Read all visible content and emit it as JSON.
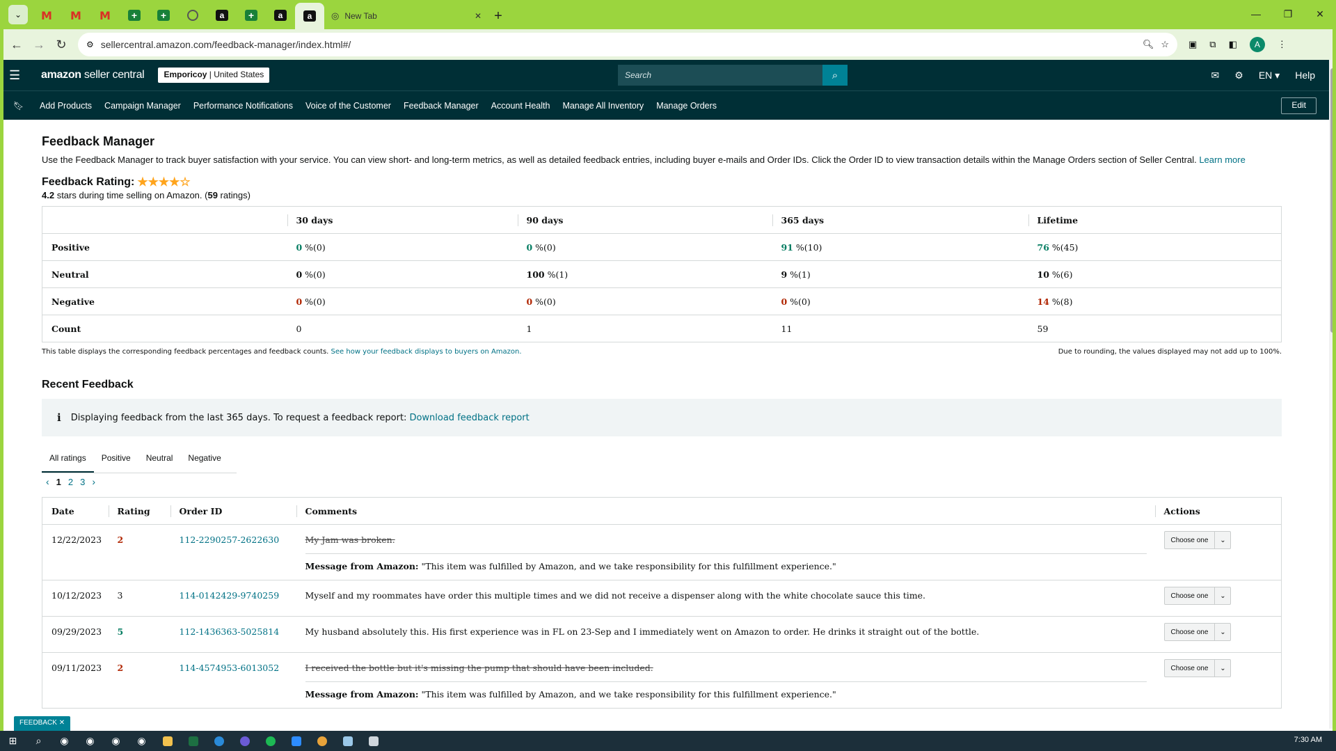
{
  "browser": {
    "tabs": [
      {
        "type": "gmail"
      },
      {
        "type": "gmail"
      },
      {
        "type": "gmail"
      },
      {
        "type": "sheets"
      },
      {
        "type": "sheets"
      },
      {
        "type": "globe"
      },
      {
        "type": "amazon"
      },
      {
        "type": "sheets"
      },
      {
        "type": "amazon"
      }
    ],
    "active_tab_favicon": "a",
    "new_tab_title": "New Tab",
    "url": "sellercentral.amazon.com/feedback-manager/index.html#/"
  },
  "header": {
    "logo_brand": "amazon",
    "logo_rest": " seller central",
    "store_name": "Emporicoy",
    "store_region": " | United States",
    "search_placeholder": "Search",
    "language": "EN",
    "help": "Help"
  },
  "nav": {
    "items": [
      "Add Products",
      "Campaign Manager",
      "Performance Notifications",
      "Voice of the Customer",
      "Feedback Manager",
      "Account Health",
      "Manage All Inventory",
      "Manage Orders"
    ],
    "edit_label": "Edit"
  },
  "page": {
    "title": "Feedback Manager",
    "intro": "Use the Feedback Manager to track buyer satisfaction with your service. You can view short- and long-term metrics, as well as detailed feedback entries, including buyer e-mails and Order IDs. Click the Order ID to view transaction details within the Manage Orders section of Seller Central. ",
    "learn_more": "Learn more",
    "rating_label": "Feedback Rating:",
    "rating_stars": "★★★★☆",
    "rating_value": "4.2",
    "rating_text_mid": " stars during time selling on Amazon. (",
    "rating_count": "59",
    "rating_text_end": " ratings)"
  },
  "metrics": {
    "columns": [
      "30 days",
      "90 days",
      "365 days",
      "Lifetime"
    ],
    "rows": [
      {
        "label": "Positive",
        "cells": [
          {
            "v": "0",
            "rest": " %(0)"
          },
          {
            "v": "0",
            "rest": " %(0)"
          },
          {
            "v": "91",
            "rest": " %(10)"
          },
          {
            "v": "76",
            "rest": " %(45)"
          }
        ]
      },
      {
        "label": "Neutral",
        "cells": [
          {
            "v": "0",
            "rest": " %(0)"
          },
          {
            "v": "100",
            "rest": " %(1)"
          },
          {
            "v": "9",
            "rest": " %(1)"
          },
          {
            "v": "10",
            "rest": " %(6)"
          }
        ]
      },
      {
        "label": "Negative",
        "cells": [
          {
            "v": "0",
            "rest": " %(0)"
          },
          {
            "v": "0",
            "rest": " %(0)"
          },
          {
            "v": "0",
            "rest": " %(0)"
          },
          {
            "v": "14",
            "rest": " %(8)"
          }
        ]
      },
      {
        "label": "Count",
        "cells": [
          {
            "v": "0",
            "rest": ""
          },
          {
            "v": "1",
            "rest": ""
          },
          {
            "v": "11",
            "rest": ""
          },
          {
            "v": "59",
            "rest": ""
          }
        ]
      }
    ],
    "note_left": "This table displays the corresponding feedback percentages and feedback counts. ",
    "note_link": "See how your feedback displays to buyers on Amazon.",
    "note_right": "Due to rounding, the values displayed may not add up to 100%."
  },
  "recent": {
    "title": "Recent Feedback",
    "info_text": "Displaying feedback from the last 365 days. To request a feedback report: ",
    "info_link": "Download feedback report",
    "tabs": [
      "All ratings",
      "Positive",
      "Neutral",
      "Negative"
    ],
    "pages": [
      "1",
      "2",
      "3"
    ],
    "columns": [
      "Date",
      "Rating",
      "Order ID",
      "Comments",
      "Actions"
    ],
    "rows": [
      {
        "date": "12/22/2023",
        "rating": "2",
        "order_id": "112-2290257-2622630",
        "comment": "My Jam was broken.",
        "struck": true,
        "amazon_label": "Message from Amazon:",
        "amazon_msg": " \"This item was fulfilled by Amazon, and we take responsibility for this fulfillment experience.\"",
        "action": "Choose one"
      },
      {
        "date": "10/12/2023",
        "rating": "3",
        "order_id": "114-0142429-9740259",
        "comment": "Myself and my roommates have order this multiple times and we did not receive a dispenser along with the white chocolate sauce this time.",
        "struck": false,
        "amazon_label": "",
        "amazon_msg": "",
        "action": "Choose one"
      },
      {
        "date": "09/29/2023",
        "rating": "5",
        "order_id": "112-1436363-5025814",
        "comment": "My husband absolutely this. His first experience was in FL on 23-Sep and I immediately went on Amazon to order. He drinks it straight out of the bottle.",
        "struck": false,
        "amazon_label": "",
        "amazon_msg": "",
        "action": "Choose one"
      },
      {
        "date": "09/11/2023",
        "rating": "2",
        "order_id": "114-4574953-6013052",
        "comment": "I received the bottle but it's missing the pump that should have been included.",
        "struck": true,
        "amazon_label": "Message from Amazon:",
        "amazon_msg": " \"This item was fulfilled by Amazon, and we take responsibility for this fulfillment experience.\"",
        "action": "Choose one"
      }
    ]
  },
  "feedback_tag": "FEEDBACK",
  "taskbar": {
    "clock": "7:30 AM"
  },
  "colors": {
    "header_bg": "#002f36",
    "link": "#007185",
    "positive": "#067d62",
    "negative": "#b12704",
    "browser_frame": "#9bd53e",
    "star": "#ffa41c"
  }
}
